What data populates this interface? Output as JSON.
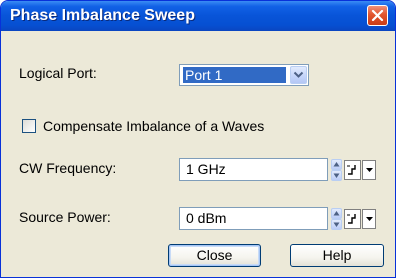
{
  "window": {
    "title": "Phase Imbalance Sweep",
    "colors": {
      "titlebar": "#0854d8",
      "background": "#ece9d8",
      "close": "#e2552e",
      "selection": "#316ac5"
    }
  },
  "logical_port": {
    "label": "Logical Port:",
    "selected": "Port 1"
  },
  "compensate": {
    "label": "Compensate Imbalance of a Waves",
    "checked": false
  },
  "cw_frequency": {
    "label": "CW Frequency:",
    "value": "1 GHz"
  },
  "source_power": {
    "label": "Source Power:",
    "value": "0 dBm"
  },
  "buttons": {
    "close": "Close",
    "help": "Help"
  },
  "icons": {
    "title_close": "close-x-icon",
    "combo_arrow": "chevron-down-icon",
    "spin_up": "triangle-up-icon",
    "spin_down": "triangle-down-icon",
    "step": "step-icon",
    "dropdown": "triangle-down-icon"
  }
}
